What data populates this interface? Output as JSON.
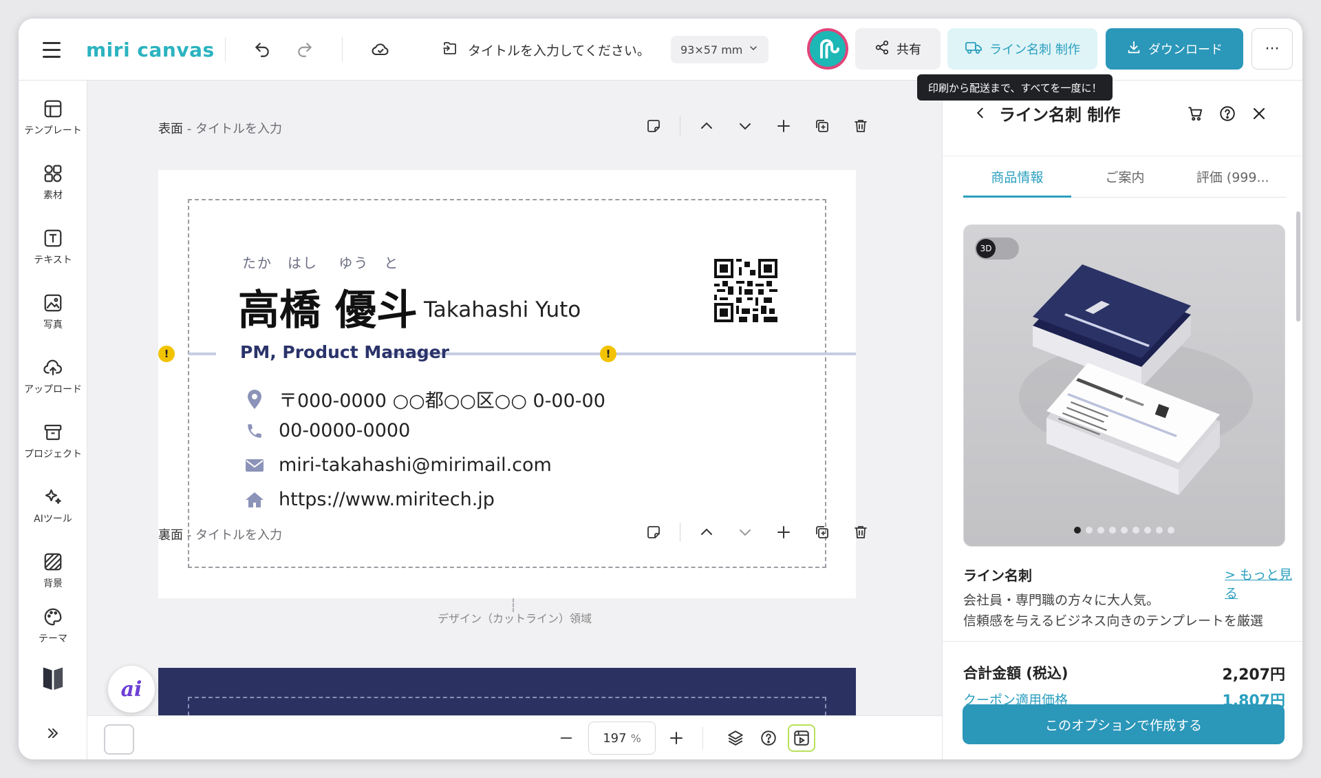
{
  "app": {
    "logo_text": "miri canvas",
    "title": "タイトルを入力してください。",
    "size": "93×57 mm",
    "accent_color": "#2b97b9"
  },
  "toolbar": {
    "share_label": "共有",
    "line_card_label": "ライン名刺 制作",
    "download_label": "ダウンロード",
    "more_label": "···",
    "tooltip": "印刷から配送まで、すべてを一度に！",
    "avatar_initial": "ල"
  },
  "sidebar": {
    "items": [
      {
        "label": "テンプレート",
        "icon": "template-icon"
      },
      {
        "label": "素材",
        "icon": "elements-icon"
      },
      {
        "label": "テキスト",
        "icon": "text-icon"
      },
      {
        "label": "写真",
        "icon": "photo-icon"
      },
      {
        "label": "アップロード",
        "icon": "upload-icon"
      },
      {
        "label": "プロジェクト",
        "icon": "project-icon"
      },
      {
        "label": "AIツール",
        "icon": "ai-tools-icon"
      },
      {
        "label": "背景",
        "icon": "background-icon"
      },
      {
        "label": "テーマ",
        "icon": "theme-icon"
      }
    ],
    "expand_label": "»"
  },
  "canvas": {
    "front_label": "表面",
    "front_sub": " - タイトルを入力",
    "back_label": "裏面",
    "back_sub": " - タイトルを入力",
    "design_area_label": "デザイン（カットライン）領域",
    "card": {
      "furigana": "たか　はし　 ゆう　と",
      "name_jp": "高橋 優斗",
      "name_en": "Takahashi Yuto",
      "role": "PM, Product Manager",
      "address": "〒000-0000 ○○都○○区○○ 0-00-00",
      "phone": "00-0000-0000",
      "email": "miri-takahashi@mirimail.com",
      "url": "https://www.miritech.jp",
      "brand_color": "#2a336a"
    },
    "ai_label": "ai"
  },
  "bottombar": {
    "zoom_value": "197",
    "zoom_unit": "%"
  },
  "panel": {
    "title": "ライン名刺 制作",
    "tabs": [
      "商品情報",
      "ご案内",
      "評価 (999..."
    ],
    "active_tab": 0,
    "toggle_3d": "3D",
    "carousel_pages": 9,
    "carousel_active": 0,
    "product_name": "ライン名刺",
    "more_link": "> もっと見る",
    "description": "会社員・専門職の方々に大人気。\n信頼感を与えるビジネス向きのテンプレートを厳選",
    "total_label": "合計金額 (税込)",
    "total_value": "2,207円",
    "coupon_label": "クーポン適用価格",
    "coupon_value": "1,807円",
    "cta_label": "このオプションで作成する"
  }
}
